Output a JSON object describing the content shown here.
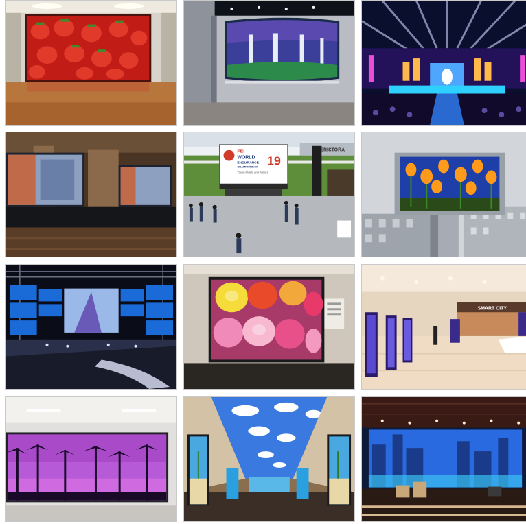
{
  "gallery": {
    "tiles": [
      {
        "name": "strawberry-indoor-screen"
      },
      {
        "name": "curved-waterfall-screen"
      },
      {
        "name": "concert-stage-screen"
      },
      {
        "name": "hall-dual-screens"
      },
      {
        "name": "endurance-championship-sign",
        "sign": {
          "brand": "FEI",
          "line1": "WORLD",
          "line2": "ENDURANCE",
          "line3": "CHAMPIONSHIP",
          "year": "19",
          "sub": "Young Riders and Juniors",
          "fence": "ERISTORA"
        }
      },
      {
        "name": "outdoor-tulip-billboard"
      },
      {
        "name": "stage-truss-screens"
      },
      {
        "name": "rose-wall-screen"
      },
      {
        "name": "mall-pillar-screens",
        "store_sign": "SMART CITY"
      },
      {
        "name": "palm-sunset-screen"
      },
      {
        "name": "sky-ceiling-screen"
      },
      {
        "name": "city-night-stage-screen"
      }
    ]
  },
  "colors": {
    "border": "#c9c9c9",
    "background": "#ffffff"
  }
}
